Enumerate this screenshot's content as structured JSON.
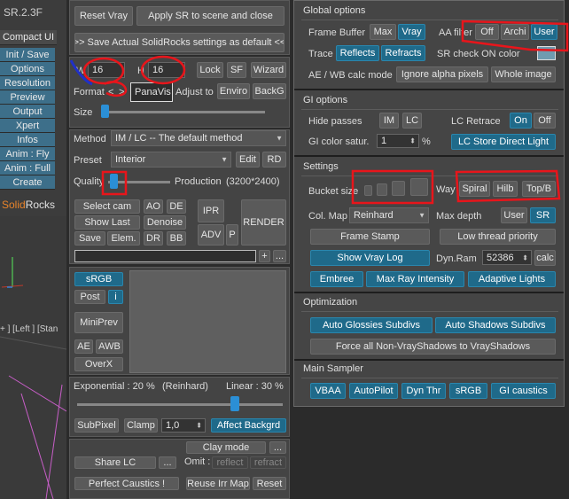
{
  "sidebar": {
    "version": "SR.2.3F",
    "buttons": [
      "Compact UI",
      "Init / Save",
      "Options",
      "Resolution",
      "Preview",
      "Output",
      "Xpert",
      "Infos",
      "Anim : Fly",
      "Anim : Full",
      "Create"
    ],
    "logo_part1": "Solid",
    "logo_part2": "Rocks",
    "viewport_label": "+ ] [Left ] [Stan"
  },
  "top": {
    "reset": "Reset Vray",
    "apply": "Apply SR to scene and close",
    "save_actual": ">> Save Actual SolidRocks settings as default <<"
  },
  "resolution": {
    "w_label": "W",
    "w_value": "16",
    "h_label": "H",
    "h_value": "16",
    "lock": "Lock",
    "sf": "SF",
    "wizard": "Wizard",
    "format_label": "Format",
    "prev": "<",
    "next": ">",
    "format_value": "PanaVis",
    "adjust_label": "Adjust to",
    "enviro": "Enviro",
    "backg": "BackG",
    "size_label": "Size",
    "size_level": 0
  },
  "method_panel": {
    "method_label": "Method",
    "method_value": "IM / LC -- The default method",
    "preset_label": "Preset",
    "preset_value": "Interior",
    "edit": "Edit",
    "rd": "RD",
    "quality_label": "Quality",
    "production_label": "Production",
    "production_res": "(3200*2400)",
    "quality_level": 0
  },
  "render_panel": {
    "select_cam": "Select cam",
    "ao": "AO",
    "de": "DE",
    "ipr": "IPR",
    "show_last": "Show Last",
    "denoise": "Denoise",
    "render": "RENDER",
    "save": "Save",
    "elem": "Elem.",
    "dr": "DR",
    "bb": "BB",
    "adv": "ADV",
    "p": "P",
    "plus": "+",
    "more": "..."
  },
  "preview_panel": {
    "srgb": "sRGB",
    "post": "Post",
    "i": "i",
    "miniprev": "MiniPrev",
    "ae": "AE",
    "awb": "AWB",
    "overx": "OverX"
  },
  "exposure": {
    "exponential": "Exponential : 20 %",
    "reinhard": "(Reinhard)",
    "linear": "Linear : 30 %",
    "level": 0.3,
    "subpixel": "SubPixel",
    "clamp": "Clamp",
    "clamp_value": "1,0",
    "affect_backgrd": "Affect Backgrd"
  },
  "bottom_left": {
    "clay_mode": "Clay mode",
    "clay_more": "...",
    "share_lc": "Share LC",
    "share_more": "...",
    "omit_label": "Omit :",
    "reflect": "reflect",
    "refract": "refract",
    "perfect_caustics": "Perfect Caustics !",
    "reuse_irr": "Reuse Irr Map",
    "reset": "Reset"
  },
  "global_options": {
    "title": "Global options",
    "frame_buffer_label": "Frame Buffer",
    "fb_max": "Max",
    "fb_vray": "Vray",
    "aa_filter_label": "AA filter",
    "aa_off": "Off",
    "aa_archi": "Archi",
    "aa_user": "User",
    "trace_label": "Trace",
    "reflects": "Reflects",
    "refracts": "Refracts",
    "sr_check_label": "SR check ON color",
    "ae_wb_label": "AE / WB calc mode",
    "ignore_alpha": "Ignore alpha pixels",
    "whole_image": "Whole image"
  },
  "gi_options": {
    "title": "GI options",
    "hide_passes_label": "Hide passes",
    "im": "IM",
    "lc": "LC",
    "lc_retrace_label": "LC Retrace",
    "on": "On",
    "off": "Off",
    "gi_color_label": "GI color satur.",
    "gi_color_value": "1",
    "percent": "%",
    "lc_store": "LC Store Direct Light"
  },
  "settings": {
    "title": "Settings",
    "bucket_size_label": "Bucket size",
    "way_label": "Way",
    "spiral": "Spiral",
    "hilb": "Hilb",
    "topb": "Top/B",
    "col_map_label": "Col. Map",
    "col_map_value": "Reinhard",
    "max_depth_label": "Max depth",
    "user": "User",
    "sr": "SR",
    "frame_stamp": "Frame Stamp",
    "low_thread": "Low thread priority",
    "show_vray_log": "Show Vray Log",
    "dyn_ram_label": "Dyn.Ram",
    "dyn_ram_value": "52386",
    "calc": "calc",
    "embree": "Embree",
    "max_ray": "Max Ray Intensity",
    "adaptive_lights": "Adaptive Lights"
  },
  "optimization": {
    "title": "Optimization",
    "auto_glossies": "Auto Glossies Subdivs",
    "auto_shadows": "Auto Shadows Subdivs",
    "force_all": "Force all Non-VrayShadows to VrayShadows"
  },
  "main_sampler": {
    "title": "Main Sampler",
    "vbaa": "VBAA",
    "autopilot": "AutoPilot",
    "dyn_thr": "Dyn Thr",
    "srgb": "sRGB",
    "gi_caustics": "GI caustics"
  },
  "colors": {
    "accent": "#1f6a8a",
    "sidebar_button": "#3d6f8a",
    "annotation": "#e8151b",
    "logo_orange": "#e8832a"
  }
}
